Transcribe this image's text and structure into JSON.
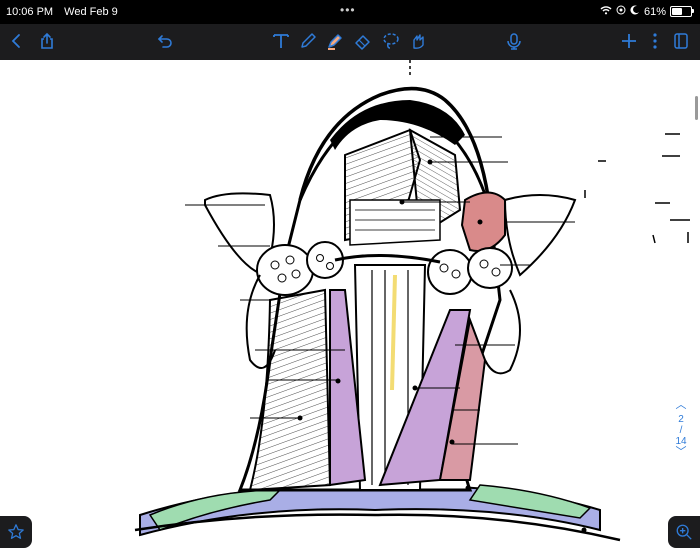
{
  "status_bar": {
    "time": "10:06 PM",
    "date": "Wed Feb 9",
    "battery": "61%",
    "battery_level": 0.61
  },
  "toolbar": {
    "left": [
      "back-icon",
      "share-icon",
      "undo-icon"
    ],
    "tools": [
      "text-tool-icon",
      "pen-tool-icon",
      "highlighter-tool-icon",
      "eraser-tool-icon",
      "lasso-tool-icon",
      "shapes-tool-icon"
    ],
    "right": [
      "microphone-icon",
      "add-icon",
      "more-icon",
      "pages-icon"
    ],
    "accent": "#2f7bd8",
    "highlighter_color": "#f5a97f"
  },
  "page_nav": {
    "current": "2",
    "separator": "/",
    "total": "14"
  },
  "drawing": {
    "colors": {
      "purple": "#c7a3d8",
      "pink": "#d99aa4",
      "red_gland": "#d98a8a",
      "green": "#9fdcb0",
      "blue": "#a9aee6",
      "yellow": "#f3dc73"
    }
  }
}
